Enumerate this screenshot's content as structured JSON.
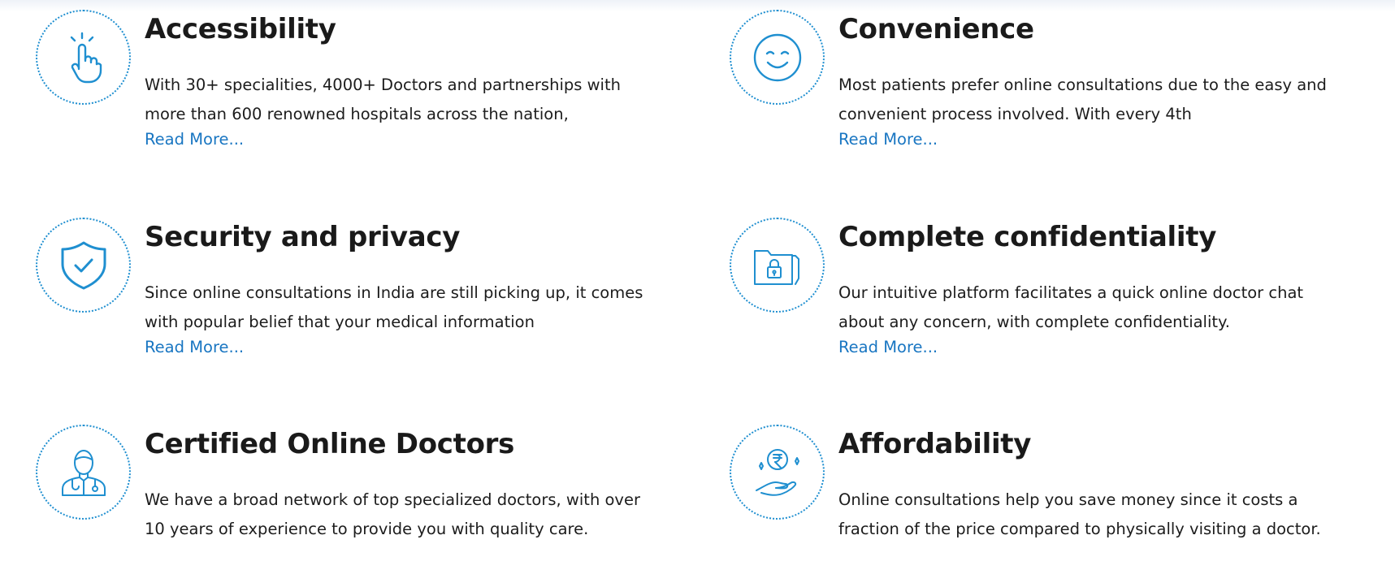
{
  "features": [
    {
      "icon": "tap-hand-icon",
      "title": "Accessibility",
      "description": "With 30+ specialities, 4000+ Doctors and partnerships with more than 600 renowned hospitals across the nation,",
      "read_more": "Read More..."
    },
    {
      "icon": "smiley-face-icon",
      "title": "Convenience",
      "description": "Most patients prefer online consultations due to the easy and convenient process involved. With every 4th",
      "read_more": "Read More..."
    },
    {
      "icon": "shield-check-icon",
      "title": "Security and privacy",
      "description": "Since online consultations in India are still picking up, it comes with popular belief that your medical information",
      "read_more": "Read More..."
    },
    {
      "icon": "locked-folder-icon",
      "title": "Complete confidentiality",
      "description": "Our intuitive platform facilitates a quick online doctor chat about any concern, with complete confidentiality.",
      "read_more": "Read More..."
    },
    {
      "icon": "doctor-icon",
      "title": "Certified Online Doctors",
      "description": "We have a broad network of top specialized doctors, with over 10 years of experience to provide you with quality care."
    },
    {
      "icon": "rupee-coin-hand-icon",
      "title": "Affordability",
      "description": "Online consultations help you save money since it costs a fraction of the price compared to physically visiting a doctor."
    }
  ],
  "colors": {
    "accent": "#1f8fd0",
    "link": "#1976c2",
    "text": "#1a1a1a"
  }
}
